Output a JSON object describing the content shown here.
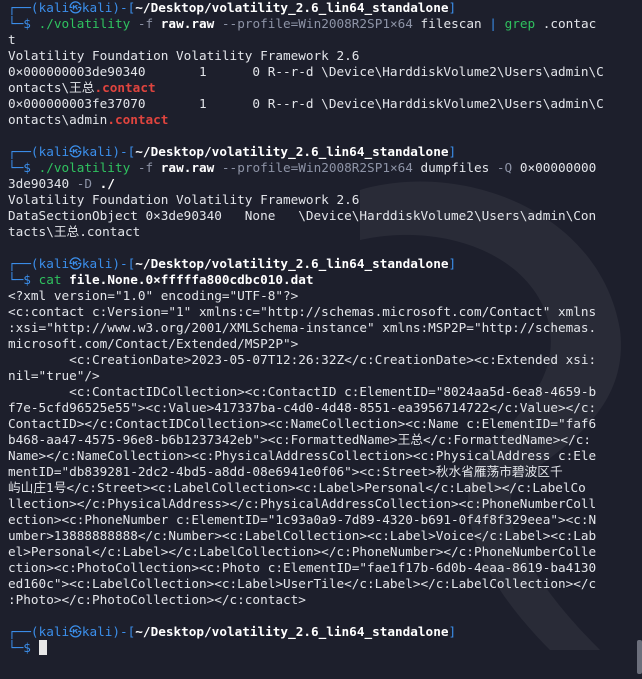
{
  "prompt": {
    "user": "kali",
    "at": "㉿",
    "host": "kali",
    "open": "┌──(",
    "close": ")-[",
    "path": "~/Desktop/volatility_2.6_lin64_standalone",
    "end": "]",
    "corner": "└─",
    "dollar": "$"
  },
  "cmd1": {
    "exe": "./volatility",
    "flag_f": "-f",
    "file": "raw.raw",
    "profile": "--profile=Win2008R2SP1×64",
    "plugin": "filescan",
    "pipe": "|",
    "grep": "grep",
    "pattern": ".contac",
    "wrap": "t"
  },
  "out1": {
    "banner": "Volatility Foundation Volatility Framework 2.6",
    "row1a": "0×000000003de90340       1      0 R--r-d \\Device\\HarddiskVolume2\\Users\\admin\\C",
    "row1b_pre": "ontacts\\王总",
    "row1b_hl": ".contact",
    "row2a": "0×000000003fe37070       1      0 R--r-d \\Device\\HarddiskVolume2\\Users\\admin\\C",
    "row2b_pre": "ontacts\\admin",
    "row2b_hl": ".contact"
  },
  "cmd2": {
    "exe": "./volatility",
    "flag_f": "-f",
    "file": "raw.raw",
    "profile": "--profile=Win2008R2SP1×64",
    "plugin": "dumpfiles",
    "flag_q": "-Q",
    "addr1": "0×00000000",
    "addr2": "3de90340",
    "flag_d": "-D",
    "dir": "./"
  },
  "out2": {
    "banner": "Volatility Foundation Volatility Framework 2.6",
    "line1": "DataSectionObject 0×3de90340   None   \\Device\\HarddiskVolume2\\Users\\admin\\Con",
    "line2": "tacts\\王总.contact"
  },
  "cmd3": {
    "exe": "cat",
    "file": "file.None.0×fffffa800cdbc010.dat"
  },
  "out3": [
    "<?xml version=\"1.0\" encoding=\"UTF-8\"?>",
    "<c:contact c:Version=\"1\" xmlns:c=\"http://schemas.microsoft.com/Contact\" xmlns",
    ":xsi=\"http://www.w3.org/2001/XMLSchema-instance\" xmlns:MSP2P=\"http://schemas.",
    "microsoft.com/Contact/Extended/MSP2P\">",
    "        <c:CreationDate>2023-05-07T12:26:32Z</c:CreationDate><c:Extended xsi:",
    "nil=\"true\"/>",
    "        <c:ContactIDCollection><c:ContactID c:ElementID=\"8024aa5d-6ea8-4659-b",
    "f7e-5cfd96525e55\"><c:Value>417337ba-c4d0-4d48-8551-ea3956714722</c:Value></c:",
    "ContactID></c:ContactIDCollection><c:NameCollection><c:Name c:ElementID=\"faf6",
    "b468-aa47-4575-96e8-b6b1237342eb\"><c:FormattedName>王总</c:FormattedName></c:",
    "Name></c:NameCollection><c:PhysicalAddressCollection><c:PhysicalAddress c:Ele",
    "mentID=\"db839281-2dc2-4bd5-a8dd-08e6941e0f06\"><c:Street>秋水省雁荡市碧波区千",
    "屿山庄1号</c:Street><c:LabelCollection><c:Label>Personal</c:Label></c:LabelCo",
    "llection></c:PhysicalAddress></c:PhysicalAddressCollection><c:PhoneNumberColl",
    "ection><c:PhoneNumber c:ElementID=\"1c93a0a9-7d89-4320-b691-0f4f8f329eea\"><c:N",
    "umber>13888888888</c:Number><c:LabelCollection><c:Label>Voice</c:Label><c:Lab",
    "el>Personal</c:Label></c:LabelCollection></c:PhoneNumber></c:PhoneNumberColle",
    "ction><c:PhotoCollection><c:Photo c:ElementID=\"fae1f17b-6d0b-4eaa-8619-ba4130",
    "ed160c\"><c:LabelCollection><c:Label>UserTile</c:Label></c:LabelCollection></c",
    ":Photo></c:PhotoCollection></c:contact>"
  ]
}
